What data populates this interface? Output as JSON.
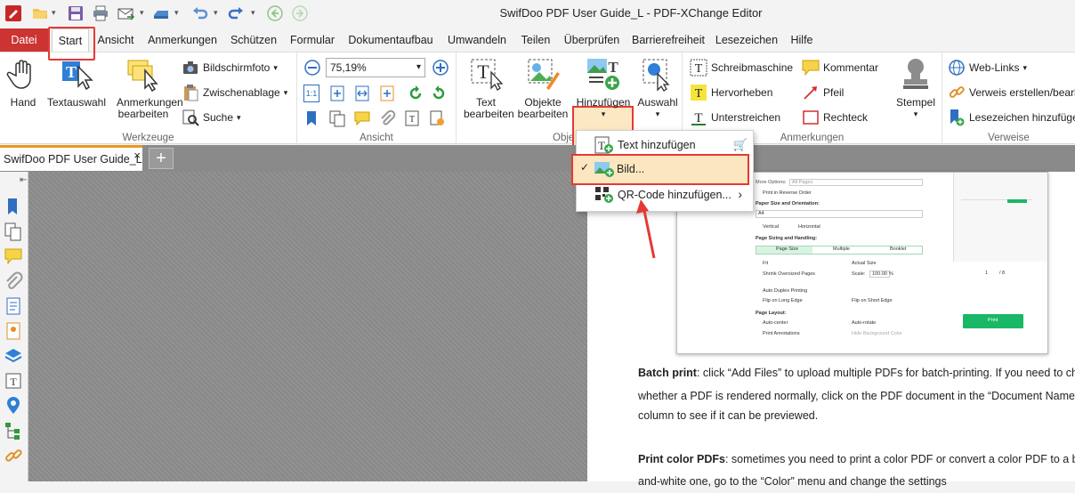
{
  "window": {
    "title": "SwifDoo PDF User Guide_L - PDF-XChange Editor"
  },
  "menu": {
    "tabs": [
      "Datei",
      "Start",
      "Ansicht",
      "Anmerkungen",
      "Schützen",
      "Formular",
      "Dokumentaufbau",
      "Umwandeln",
      "Teilen",
      "Überprüfen",
      "Barrierefreiheit",
      "Lesezeichen",
      "Hilfe"
    ]
  },
  "ribbon": {
    "werkzeuge": {
      "label": "Werkzeuge",
      "hand": "Hand",
      "textauswahl": "Textauswahl",
      "anmerkungen_bearbeiten": "Anmerkungen bearbeiten",
      "bildschirmfoto": "Bildschirmfoto",
      "zwischenablage": "Zwischenablage",
      "suche": "Suche"
    },
    "ansicht": {
      "label": "Ansicht",
      "zoom": "75,19%",
      "one_to_one": "1:1"
    },
    "objekte": {
      "label": "Obje",
      "text_bearbeiten": "Text bearbeiten",
      "objekte_bearbeiten": "Objekte bearbeiten",
      "hinzufuegen": "Hinzufügen",
      "auswahl": "Auswahl"
    },
    "anmerkungen": {
      "label": "Anmerkungen",
      "schreibmaschine": "Schreibmaschine",
      "kommentar": "Kommentar",
      "hervorheben": "Hervorheben",
      "pfeil": "Pfeil",
      "unterstreichen": "Unterstreichen",
      "rechteck": "Rechteck",
      "stempel": "Stempel"
    },
    "verweise": {
      "label": "Verweise",
      "weblinks": "Web-Links",
      "verweis": "Verweis erstellen/bearbeiten",
      "lesezeichen": "Lesezeichen hinzufügen"
    }
  },
  "doc_tab": {
    "title": "SwifDoo PDF User Guide_L",
    "close": "×",
    "new": "+"
  },
  "dropdown": {
    "items": [
      {
        "label": "Text hinzufügen"
      },
      {
        "label": "Bild...",
        "check": "✓"
      },
      {
        "label": "QR-Code hinzufügen...",
        "arrow": "›"
      }
    ]
  },
  "screenshot_embed": {
    "more_options": "More Options:",
    "all_pages": "All Pages",
    "print_reverse": "Print in Reverse Order",
    "paper_size": "Paper Size and Orientation:",
    "a4": "A4",
    "vertical": "Vertical",
    "horizontal": "Horizontal",
    "sizing": "Page Sizing and Handling:",
    "page_size": "Page Size",
    "multiple": "Multiple",
    "booklet": "Booklet",
    "fit": "Fit",
    "actual_size": "Actual Size",
    "shrink": "Shrink Oversized Pages",
    "scale": "Scale:",
    "scale_val": "100.00",
    "pct": "%",
    "auto_duplex": "Auto Duplex Printing",
    "flip_long": "Flip on Long Edge",
    "flip_short": "Flip on Short Edge",
    "page_layout": "Page Layout:",
    "auto_center": "Auto-center",
    "auto_rotate": "Auto-rotate",
    "print_annot": "Print Annotations",
    "hide_bg": "Hide Background Color",
    "page_num": "1",
    "page_total": "/ 8",
    "print": "Print"
  },
  "document": {
    "batch_bold": "Batch print",
    "batch_line1": ": click “Add Files” to upload multiple PDFs for batch-printing. If you need to check",
    "batch_line2": "whether a PDF is rendered normally, click on the PDF document in the “Document Name”",
    "batch_line3": "column to see if it can be previewed.",
    "color_bold": "Print color PDFs",
    "color_line1": ": sometimes you need to print a color PDF or convert a color PDF to a black",
    "color_line2": "and-white one, go to the “Color” menu and change the settings"
  },
  "colors": {
    "accent": "#e53935",
    "datei": "#cc3333",
    "highlight": "#fbe6bf"
  }
}
